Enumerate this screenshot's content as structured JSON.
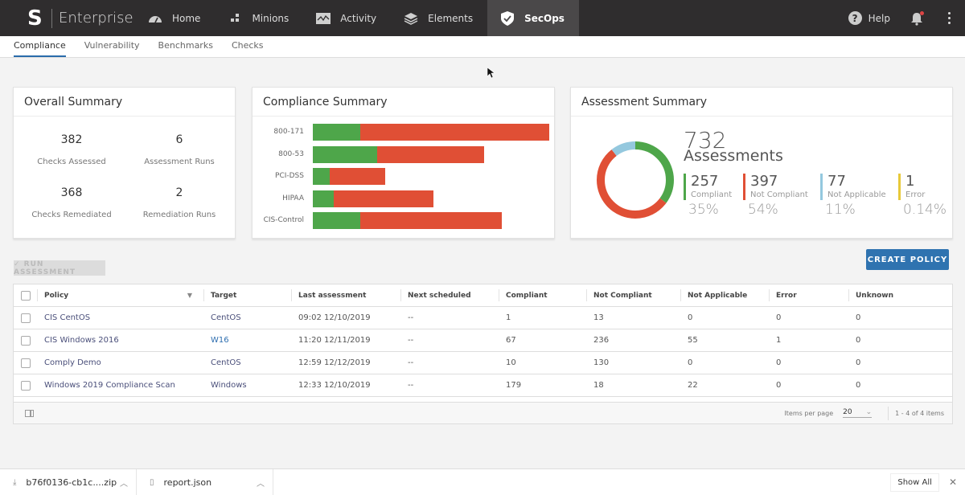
{
  "app": {
    "brand": "Enterprise",
    "logo_glyph": "S"
  },
  "topnav": {
    "items": [
      {
        "label": "Home",
        "icon": "dashboard-gauge-icon"
      },
      {
        "label": "Minions",
        "icon": "minions-grid-icon"
      },
      {
        "label": "Activity",
        "icon": "activity-graph-icon"
      },
      {
        "label": "Elements",
        "icon": "layers-icon"
      },
      {
        "label": "SecOps",
        "icon": "shield-check-icon",
        "active": true
      }
    ],
    "help_label": "Help",
    "notification_badge": true
  },
  "subnav": {
    "tabs": [
      {
        "label": "Compliance",
        "active": true
      },
      {
        "label": "Vulnerability"
      },
      {
        "label": "Benchmarks"
      },
      {
        "label": "Checks"
      }
    ]
  },
  "overall_summary": {
    "title": "Overall Summary",
    "stats": [
      {
        "value": "382",
        "label": "Checks Assessed"
      },
      {
        "value": "6",
        "label": "Assessment Runs"
      },
      {
        "value": "368",
        "label": "Checks Remediated"
      },
      {
        "value": "2",
        "label": "Remediation Runs"
      }
    ]
  },
  "compliance_summary": {
    "title": "Compliance Summary"
  },
  "chart_data": [
    {
      "type": "bar",
      "orientation": "horizontal-stacked",
      "title": "Compliance Summary",
      "categories": [
        "800-171",
        "800-53",
        "PCI-DSS",
        "HIPAA",
        "CIS-Control"
      ],
      "series": [
        {
          "name": "Compliant",
          "color": "#4ea64a",
          "values": [
            59,
            80,
            21,
            26,
            59
          ]
        },
        {
          "name": "Not Compliant",
          "color": "#e04f35",
          "values": [
            235,
            133,
            69,
            124,
            176
          ]
        }
      ],
      "axis_shown": false,
      "grid": false
    },
    {
      "type": "pie",
      "variant": "donut",
      "title": "Assessment Summary",
      "total": 732,
      "slices": [
        {
          "label": "Compliant",
          "value": 257,
          "color": "#4ea64a"
        },
        {
          "label": "Not Compliant",
          "value": 397,
          "color": "#e04f35"
        },
        {
          "label": "Not Applicable",
          "value": 77,
          "color": "#94c8de"
        },
        {
          "label": "Error",
          "value": 1,
          "color": "#e8c93a"
        }
      ]
    }
  ],
  "assessment_summary": {
    "title": "Assessment Summary",
    "total": "732",
    "total_label": "Assessments",
    "legend": [
      {
        "value": "257",
        "label": "Compliant",
        "percent": "35%",
        "color": "#4ea64a"
      },
      {
        "value": "397",
        "label": "Not Compliant",
        "percent": "54%",
        "color": "#e04f35"
      },
      {
        "value": "77",
        "label": "Not Applicable",
        "percent": "11%",
        "color": "#94c8de"
      },
      {
        "value": "1",
        "label": "Error",
        "percent": "0.14%",
        "color": "#e8c93a"
      }
    ]
  },
  "actions": {
    "run_assessment": "✓ RUN ASSESSMENT",
    "create_policy": "CREATE POLICY"
  },
  "table": {
    "columns": [
      "Policy",
      "Target",
      "Last assessment",
      "Next scheduled",
      "Compliant",
      "Not Compliant",
      "Not Applicable",
      "Error",
      "Unknown"
    ],
    "rows": [
      {
        "policy": "CIS CentOS",
        "target": "CentOS",
        "last": "09:02 12/10/2019",
        "next": "--",
        "compliant": "1",
        "not_compliant": "13",
        "not_applicable": "0",
        "error": "0",
        "unknown": "0"
      },
      {
        "policy": "CIS Windows 2016",
        "target": "W16",
        "last": "11:20 12/11/2019",
        "next": "--",
        "compliant": "67",
        "not_compliant": "236",
        "not_applicable": "55",
        "error": "1",
        "unknown": "0"
      },
      {
        "policy": "Comply Demo",
        "target": "CentOS",
        "last": "12:59 12/12/2019",
        "next": "--",
        "compliant": "10",
        "not_compliant": "130",
        "not_applicable": "0",
        "error": "0",
        "unknown": "0"
      },
      {
        "policy": "Windows 2019 Compliance Scan",
        "target": "Windows",
        "last": "12:33 12/10/2019",
        "next": "--",
        "compliant": "179",
        "not_compliant": "18",
        "not_applicable": "22",
        "error": "0",
        "unknown": "0"
      }
    ],
    "footer": {
      "items_per_page_label": "Items per page",
      "items_per_page": "20",
      "range": "1 - 4 of 4 items"
    }
  },
  "downloads": {
    "items": [
      {
        "name": "b76f0136-cb1c....zip"
      },
      {
        "name": "report.json"
      }
    ],
    "show_all": "Show All",
    "close": "✕"
  }
}
